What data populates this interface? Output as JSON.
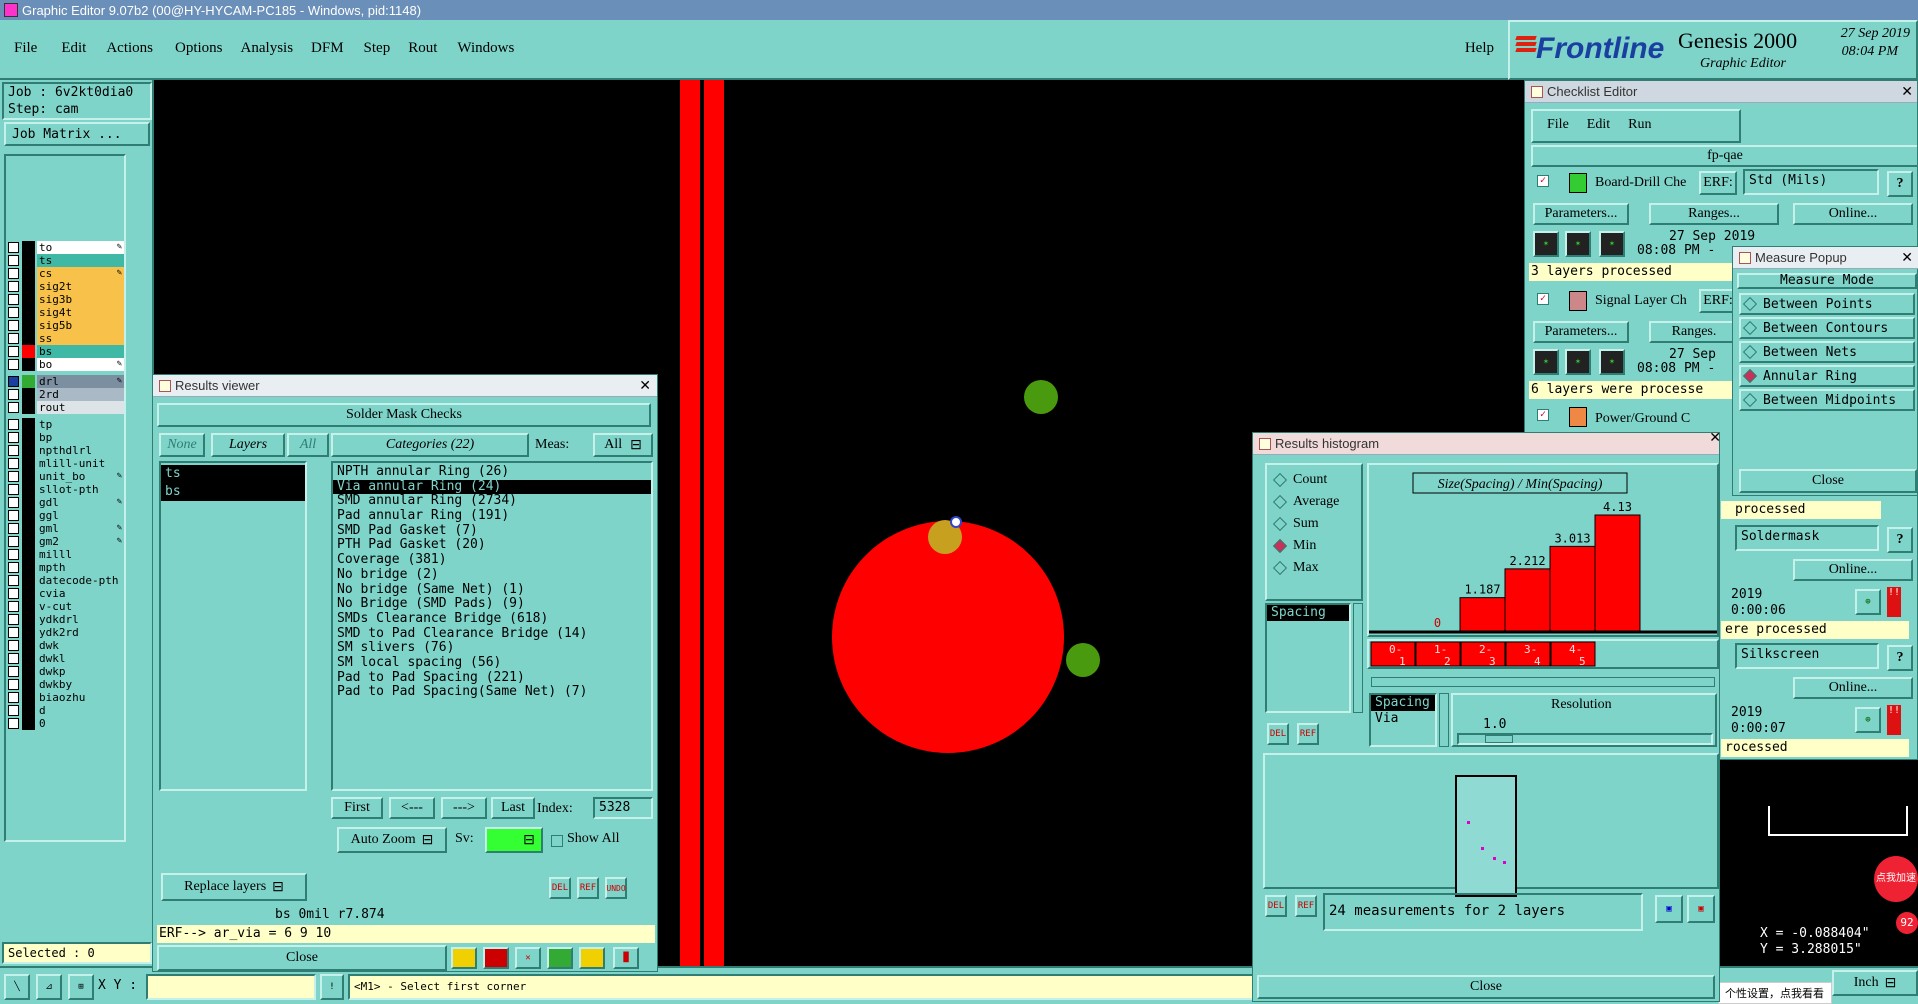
{
  "titlebar": {
    "text": "Graphic Editor 9.07b2 (00@HY-HYCAM-PC185 - Windows, pid:1148)"
  },
  "menu": {
    "items": [
      "File",
      "Edit",
      "Actions",
      "Options",
      "Analysis",
      "DFM",
      "Step",
      "Rout",
      "Windows"
    ],
    "help": "Help"
  },
  "brand": {
    "logo": "Frontline",
    "product": "Genesis 2000",
    "subtitle": "Graphic Editor",
    "date": "27 Sep 2019",
    "time": "08:04 PM"
  },
  "job": {
    "job_label": "Job : 6v2kt0dia0",
    "step_label": "Step: cam",
    "job_matrix": "Job Matrix ..."
  },
  "layers": [
    {
      "name": "to",
      "color": "#ffffff",
      "pen": true
    },
    {
      "name": "ts",
      "color": "#3fb8a6",
      "pen": false
    },
    {
      "name": "cs",
      "color": "#f8c24a",
      "pen": true
    },
    {
      "name": "sig2t",
      "color": "#f8c24a",
      "pen": false
    },
    {
      "name": "sig3b",
      "color": "#f8c24a",
      "pen": false
    },
    {
      "name": "sig4t",
      "color": "#f8c24a",
      "pen": false
    },
    {
      "name": "sig5b",
      "color": "#f8c24a",
      "pen": false
    },
    {
      "name": "ss",
      "color": "#f8c24a",
      "pen": false
    },
    {
      "name": "bs",
      "color": "#3fb8a6",
      "pen": false
    },
    {
      "name": "bo",
      "color": "#ffffff",
      "pen": true
    },
    {
      "name": "drl",
      "color": "#7c8fa0",
      "pen": true
    },
    {
      "name": "2rd",
      "color": "#a9b9c5",
      "pen": false
    },
    {
      "name": "rout",
      "color": "#dde4e7",
      "pen": false
    },
    {
      "name": "tp",
      "color": "#7fd4ca",
      "pen": false
    },
    {
      "name": "bp",
      "color": "#7fd4ca",
      "pen": false
    },
    {
      "name": "npthdlrl",
      "color": "#7fd4ca",
      "pen": false
    },
    {
      "name": "mlill-unit",
      "color": "#7fd4ca",
      "pen": false
    },
    {
      "name": "unit_bo",
      "color": "#7fd4ca",
      "pen": true
    },
    {
      "name": "sllot-pth",
      "color": "#7fd4ca",
      "pen": false
    },
    {
      "name": "gdl",
      "color": "#7fd4ca",
      "pen": true
    },
    {
      "name": "ggl",
      "color": "#7fd4ca",
      "pen": false
    },
    {
      "name": "gml",
      "color": "#7fd4ca",
      "pen": true
    },
    {
      "name": "gm2",
      "color": "#7fd4ca",
      "pen": true
    },
    {
      "name": "milll",
      "color": "#7fd4ca",
      "pen": false
    },
    {
      "name": "mpth",
      "color": "#7fd4ca",
      "pen": false
    },
    {
      "name": "datecode-pth",
      "color": "#7fd4ca",
      "pen": false
    },
    {
      "name": "cvia",
      "color": "#7fd4ca",
      "pen": false
    },
    {
      "name": "v-cut",
      "color": "#7fd4ca",
      "pen": false
    },
    {
      "name": "ydkdrl",
      "color": "#7fd4ca",
      "pen": false
    },
    {
      "name": "ydk2rd",
      "color": "#7fd4ca",
      "pen": false
    },
    {
      "name": "dwk",
      "color": "#7fd4ca",
      "pen": false
    },
    {
      "name": "dwkl",
      "color": "#7fd4ca",
      "pen": false
    },
    {
      "name": "dwkp",
      "color": "#7fd4ca",
      "pen": false
    },
    {
      "name": "dwkby",
      "color": "#7fd4ca",
      "pen": false
    },
    {
      "name": "biaozhu",
      "color": "#7fd4ca",
      "pen": false
    },
    {
      "name": "d",
      "color": "#7fd4ca",
      "pen": false
    },
    {
      "name": "0",
      "color": "#7fd4ca",
      "pen": false
    }
  ],
  "selected": "Selected : 0",
  "results_viewer": {
    "title": "Results viewer",
    "header": "Solder Mask Checks",
    "none": "None",
    "layers_btn": "Layers",
    "all": "All",
    "layer_list": [
      "ts",
      "bs"
    ],
    "categories": "Categories (22)",
    "meas_label": "Meas:",
    "meas_value": "All",
    "items": [
      "NPTH annular Ring (26)",
      "Via annular Ring (24)",
      "SMD annular Ring (2734)",
      "Pad annular Ring (191)",
      "SMD Pad Gasket (7)",
      "PTH Pad Gasket (20)",
      "Coverage (381)",
      "No bridge (2)",
      "No bridge (Same Net) (1)",
      "No Bridge (SMD Pads) (9)",
      "SMDs Clearance Bridge (618)",
      "SMD to Pad Clearance Bridge (14)",
      "SM slivers (76)",
      "SM local spacing (56)",
      "Pad to Pad Spacing (221)",
      "Pad to Pad Spacing(Same Net) (7)"
    ],
    "first": "First",
    "prev": "<---",
    "next": "--->",
    "last": "Last",
    "index_label": "Index:",
    "index_value": "5328",
    "auto_zoom": "Auto Zoom",
    "sv_label": "Sv:",
    "show_all": "Show All",
    "replace_layers": "Replace layers",
    "del": "DEL",
    "ref": "REF",
    "undo": "UNDO",
    "info": "bs 0mil   r7.874",
    "erf": "ERF--> ar_via = 6 9 10",
    "close": "Close"
  },
  "checklist": {
    "title": "Checklist Editor",
    "menu": [
      "File",
      "Edit",
      "Run"
    ],
    "name": "fp-qae",
    "erf": "ERF:",
    "std": "Std (Mils)",
    "q": "?",
    "checks": [
      {
        "name": "Board-Drill Che",
        "params": "Parameters...",
        "ranges": "Ranges...",
        "online": "Online...",
        "date": "27 Sep 2019",
        "time": "08:08 PM -",
        "status": "3 layers processed"
      },
      {
        "name": "Signal Layer Ch",
        "params": "Parameters...",
        "ranges": "Ranges.",
        "date": "27 Sep",
        "time": "08:08 PM -",
        "status": "6 layers were processe"
      },
      {
        "name": "Power/Ground C"
      }
    ],
    "right_items": [
      {
        "status": "processed",
        "field": "Soldermask",
        "online": "Online...",
        "date": "2019",
        "time": "0:00:06",
        "status2": "ere processed"
      },
      {
        "field": "Silkscreen",
        "online": "Online...",
        "date": "2019",
        "time": "0:00:07",
        "status2": "rocessed"
      }
    ],
    "frag": "e"
  },
  "measure": {
    "title": "Measure Popup",
    "mode": "Measure Mode",
    "options": [
      "Between Points",
      "Between Contours",
      "Between Nets",
      "Annular Ring",
      "Between Midpoints"
    ],
    "selected": "Annular Ring",
    "close": "Close"
  },
  "histogram": {
    "title": "Results histogram",
    "options": [
      "Count",
      "Average",
      "Sum",
      "Min",
      "Max"
    ],
    "selected": "Min",
    "stat_list": [
      "Spacing"
    ],
    "chart_title": "Size(Spacing) / Min(Spacing)",
    "spacing_list": [
      "Spacing",
      "Via"
    ],
    "resolution_label": "Resolution",
    "resolution_value": "1.0",
    "summary": "24 measurements for 2 layers",
    "close": "Close",
    "del": "DEL",
    "ref": "REF"
  },
  "chart_data": {
    "type": "bar",
    "title": "Size(Spacing) / Min(Spacing)",
    "categories": [
      "0-1",
      "1-2",
      "2-3",
      "3-4",
      "4-5"
    ],
    "values": [
      0,
      1.187,
      2.212,
      3.013,
      4.13
    ],
    "data_labels": [
      "0",
      "1.187",
      "2.212",
      "3.013",
      "4.13"
    ],
    "ylim": [
      0,
      4.13
    ]
  },
  "statusbar": {
    "xy_label": "X Y :",
    "prompt": "<M1> - Select first corner"
  },
  "coords": {
    "x": "X = -0.088404\"",
    "y": "Y = 3.288015\""
  },
  "unit": "Inch",
  "toast": {
    "text": "个性设置，点我看看",
    "badge_text": "点我加速",
    "badge_num": "92"
  },
  "colors": {
    "teal": "#7fd4ca",
    "red": "#ff0000",
    "green": "#4a9a10",
    "pad": "#c8a020"
  }
}
